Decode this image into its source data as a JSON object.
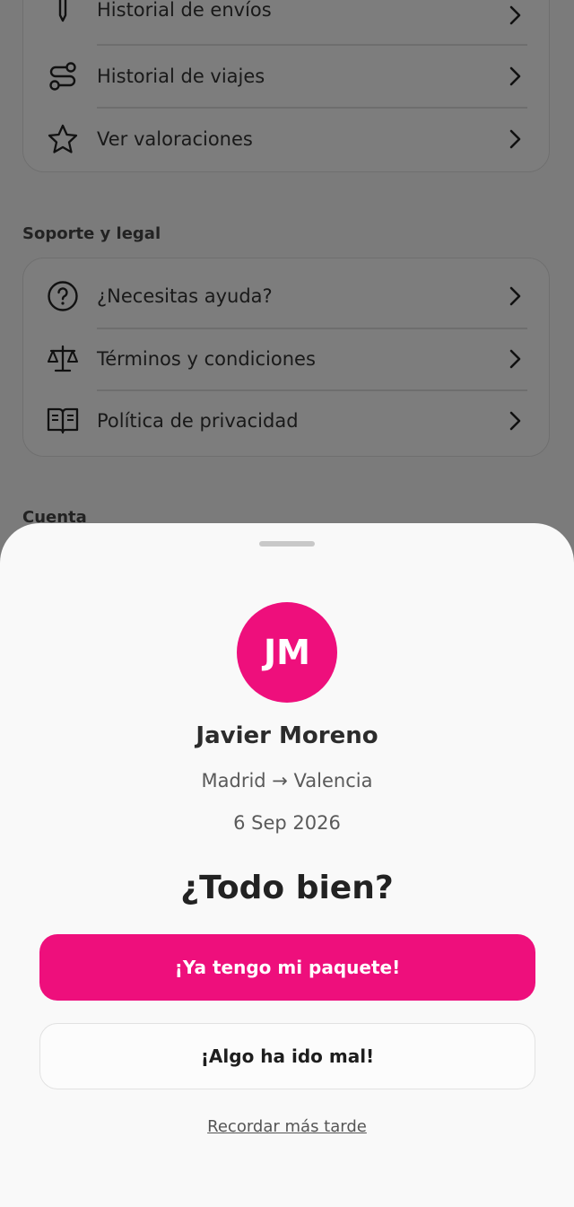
{
  "background": {
    "card1": {
      "items": [
        {
          "label": "Historial de envíos",
          "icon": "pen-icon"
        },
        {
          "label": "Historial de viajes",
          "icon": "route-icon"
        },
        {
          "label": "Ver valoraciones",
          "icon": "star-icon"
        }
      ]
    },
    "support_section": {
      "title": "Soporte y legal",
      "items": [
        {
          "label": "¿Necesitas ayuda?",
          "icon": "help-icon"
        },
        {
          "label": "Términos y condiciones",
          "icon": "scale-icon"
        },
        {
          "label": "Política de privacidad",
          "icon": "book-icon"
        }
      ]
    },
    "account_section": {
      "title": "Cuenta"
    }
  },
  "sheet": {
    "avatar_initials": "JM",
    "avatar_color": "#ee0f7c",
    "name": "Javier Moreno",
    "route": "Madrid → Valencia",
    "date": "6 Sep 2026",
    "question": "¿Todo bien?",
    "primary_button": "¡Ya tengo mi paquete!",
    "secondary_button": "¡Algo ha ido mal!",
    "later_link": "Recordar más tarde"
  }
}
